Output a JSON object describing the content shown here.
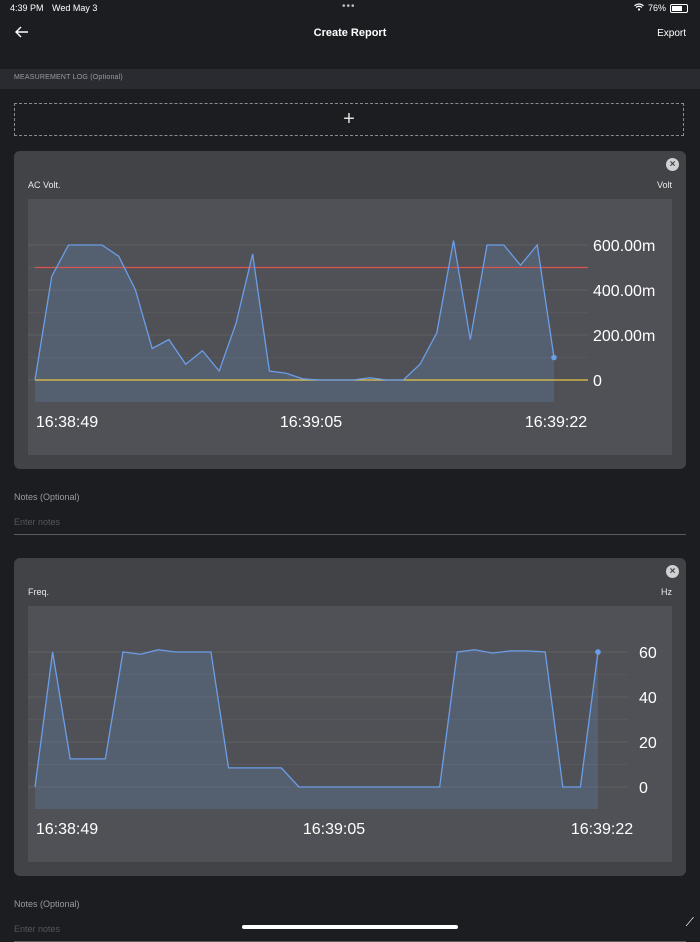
{
  "status": {
    "time": "4:39 PM",
    "date": "Wed May 3",
    "battery": "76%"
  },
  "nav": {
    "title": "Create Report",
    "export_label": "Export"
  },
  "section": {
    "measurement_log_label": "MEASUREMENT LOG (Optional)"
  },
  "add_button": {
    "glyph": "+"
  },
  "cards": [
    {
      "title": "AC Volt.",
      "unit": "Volt",
      "chart_data": {
        "type": "area",
        "x_tick_labels": [
          "16:38:49",
          "16:39:05",
          "16:39:22"
        ],
        "y_tick_labels": [
          "600.00m",
          "400.00m",
          "200.00m",
          "0"
        ],
        "y_ticks": [
          600,
          400,
          200,
          0
        ],
        "ylim": [
          -100,
          800
        ],
        "series_color": "#6b9ee8",
        "threshold_high": 500,
        "threshold_high_color": "#d9534f",
        "threshold_low": 0,
        "threshold_low_color": "#e8c547",
        "values": [
          0,
          460,
          600,
          600,
          600,
          550,
          400,
          140,
          180,
          70,
          130,
          40,
          250,
          560,
          40,
          30,
          5,
          0,
          0,
          0,
          10,
          0,
          0,
          70,
          210,
          620,
          180,
          600,
          600,
          510,
          600,
          100
        ]
      }
    },
    {
      "title": "Freq.",
      "unit": "Hz",
      "chart_data": {
        "type": "area",
        "x_tick_labels": [
          "16:38:49",
          "16:39:05",
          "16:39:22"
        ],
        "y_tick_labels": [
          "60",
          "40",
          "20",
          "0"
        ],
        "y_ticks": [
          60,
          40,
          20,
          0
        ],
        "ylim": [
          -10,
          80
        ],
        "series_color": "#6b9ee8",
        "values": [
          0,
          60,
          12.5,
          12.5,
          12.5,
          60,
          59,
          61,
          60,
          60,
          60,
          8.5,
          8.5,
          8.5,
          8.5,
          0,
          0,
          0,
          0,
          0,
          0,
          0,
          0,
          0,
          60,
          61,
          59.5,
          60.5,
          60.5,
          60,
          0,
          0,
          60
        ]
      }
    }
  ],
  "notes": {
    "label": "Notes (Optional)",
    "placeholder": "Enter notes"
  }
}
